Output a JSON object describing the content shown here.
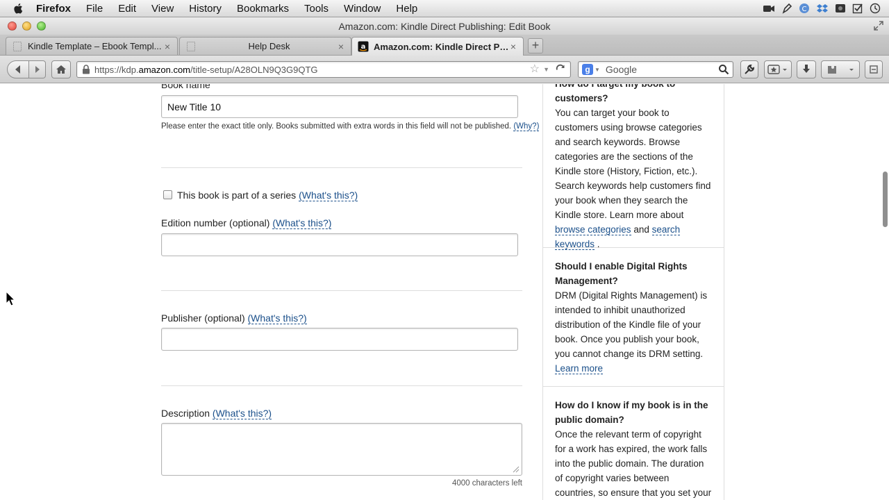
{
  "menubar": {
    "items": [
      "Firefox",
      "File",
      "Edit",
      "View",
      "History",
      "Bookmarks",
      "Tools",
      "Window",
      "Help"
    ],
    "tray_icons": [
      "camera-icon",
      "pen-icon",
      "sync-icon",
      "dropbox-icon",
      "screen-record-icon",
      "checkbox-icon",
      "time-machine-icon"
    ]
  },
  "window": {
    "title": "Amazon.com: Kindle Direct Publishing: Edit Book"
  },
  "tabs": [
    {
      "label": "Kindle Template – Ebook Templ...",
      "close": "×",
      "active": false
    },
    {
      "label": "Help Desk",
      "close": "×",
      "active": false
    },
    {
      "label": "Amazon.com: Kindle Direct Publ...",
      "close": "×",
      "active": true
    }
  ],
  "newtab_label": "+",
  "navbar": {
    "url_prefix": "https://kdp.",
    "url_domain": "amazon.com",
    "url_path": "/title-setup/A28OLN9Q3G9QTG",
    "search_engine_letter": "g",
    "search_placeholder": "Google"
  },
  "form": {
    "book_name_label": "Book name",
    "book_name_value": "New Title 10",
    "book_name_note": "Please enter the exact title only. Books submitted with extra words in this field will not be published.",
    "why_link": "(Why?)",
    "series_label": "This book is part of a series",
    "whats_this": "(What's this?)",
    "edition_label": "Edition number (optional)",
    "edition_value": "",
    "publisher_label": "Publisher (optional)",
    "publisher_value": "",
    "description_label": "Description",
    "description_value": "",
    "chars_left": "4000 characters left"
  },
  "sidebar": {
    "box1": {
      "question_top": "How do I target my book to",
      "question_bottom": "customers?",
      "body": "You can target your book to customers using browse categories and search keywords. Browse categories are the sections of the Kindle store (History, Fiction, etc.). Search keywords help customers find your book when they search the Kindle store. Learn more about",
      "link1": "browse categories",
      "and": "and",
      "link2": "search keywords",
      "end": "."
    },
    "box2": {
      "question": "Should I enable Digital Rights Management?",
      "body": "DRM (Digital Rights Management) is intended to inhibit unauthorized distribution of the Kindle file of your book. Once you publish your book, you cannot change its DRM setting.",
      "link": "Learn more"
    },
    "box3": {
      "question": "How do I know if my book is in the public domain?",
      "body": "Once the relevant term of copyright for a work has expired, the work falls into the public domain. The duration of copyright varies between countries, so ensure that you set your territory rights"
    }
  }
}
